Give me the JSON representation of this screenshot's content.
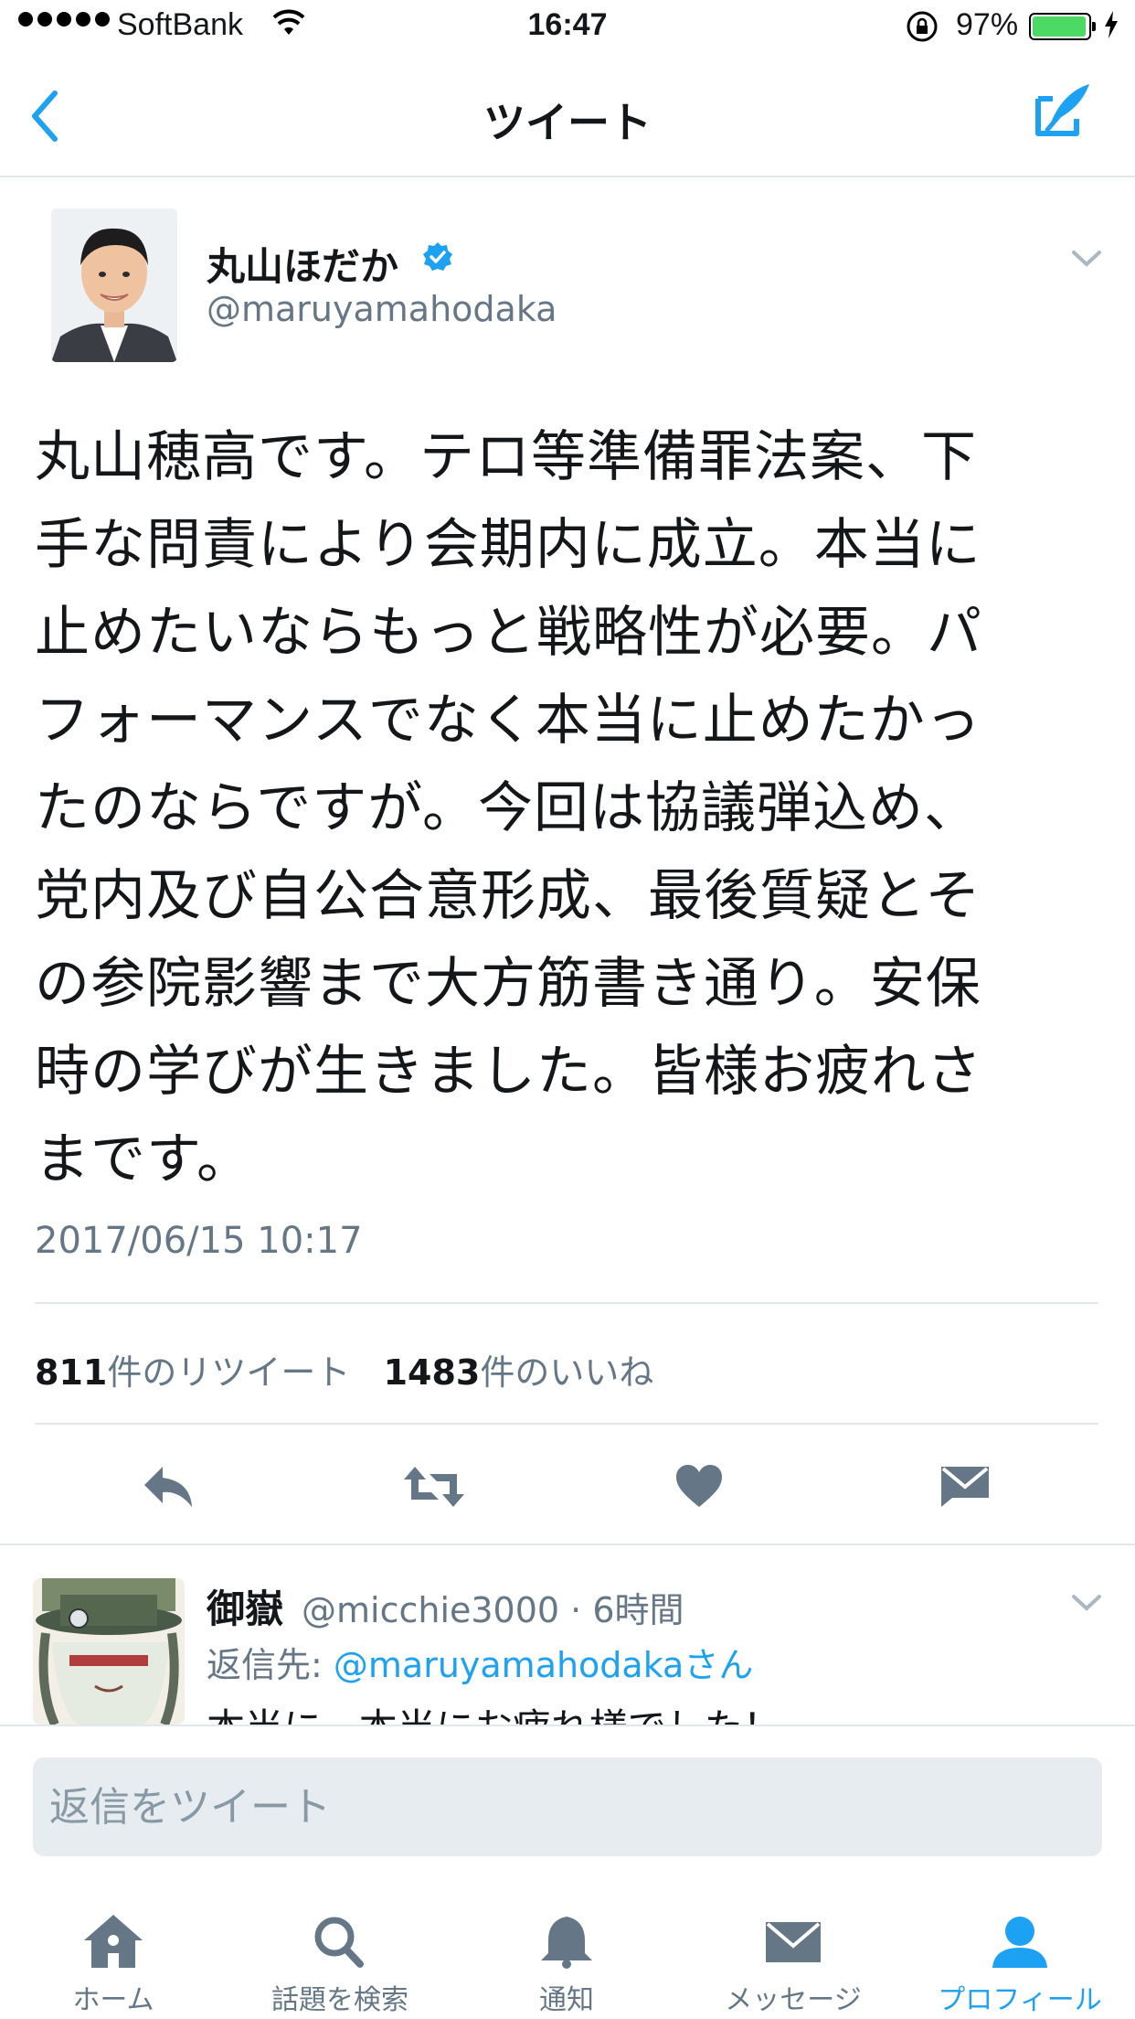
{
  "status_bar": {
    "carrier": "SoftBank",
    "time": "16:47",
    "battery_percent": "97%",
    "battery_level": 0.97
  },
  "nav": {
    "title": "ツイート",
    "icons": [
      "back-chevron-icon",
      "compose-tweet-icon"
    ]
  },
  "tweet": {
    "author_name": "丸山ほだか",
    "author_handle": "@maruyamahodaka",
    "verified": true,
    "lines": [
      "丸山穂高です。テロ等準備罪法案、下",
      "手な問責により会期内に成立。本当に",
      "止めたいならもっと戦略性が必要。パ",
      "フォーマンスでなく本当に止めたかっ",
      "たのならですが。今回は協議弾込め、",
      "党内及び自公合意形成、最後質疑とそ",
      "の参院影響まで大方筋書き通り。安保",
      "時の学びが生きました。皆様お疲れさ",
      "まです。"
    ],
    "timestamp": "2017/06/15 10:17",
    "retweet_count": "811",
    "retweet_suffix": "件のリツイート",
    "like_count": "1483",
    "like_suffix": "件のいいね",
    "actions": [
      "reply-icon",
      "retweet-icon",
      "like-icon",
      "direct-message-icon"
    ]
  },
  "reply": {
    "name": "御嶽",
    "meta": "@micchie3000 · 6時間",
    "reply_to_prefix": "返信先: ",
    "reply_to_mention": "@maruyamahodakaさん",
    "text": "本当に、本当にお疲れ様でした！"
  },
  "compose": {
    "placeholder": "返信をツイート"
  },
  "tabbar": {
    "tabs": [
      {
        "label": "ホーム",
        "icon": "home-icon",
        "active": false
      },
      {
        "label": "話題を検索",
        "icon": "search-icon",
        "active": false
      },
      {
        "label": "通知",
        "icon": "bell-icon",
        "active": false
      },
      {
        "label": "メッセージ",
        "icon": "envelope-icon",
        "active": false
      },
      {
        "label": "プロフィール",
        "icon": "profile-icon",
        "active": true
      }
    ]
  },
  "colors": {
    "accent": "#1da1f2",
    "muted": "#657786",
    "icon_gray": "#657786",
    "battery_green": "#4cd964"
  }
}
